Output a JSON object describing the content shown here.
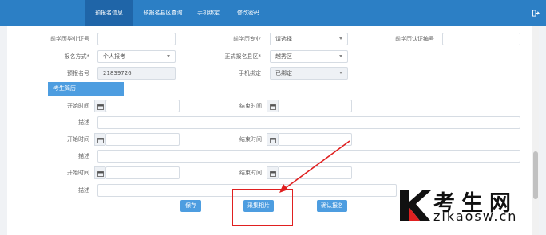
{
  "nav": {
    "tabs": [
      {
        "label": "预报名信息",
        "active": true
      },
      {
        "label": "预报名县区查询",
        "active": false
      },
      {
        "label": "手机绑定",
        "active": false
      },
      {
        "label": "修改密码",
        "active": false
      }
    ]
  },
  "form": {
    "prev_cert_label": "前学历毕业证号",
    "prev_cert_value": "",
    "prev_major_label": "前学历专业",
    "prev_major_value": "请选择",
    "prev_auth_label": "前学历认证编号",
    "prev_auth_value": "",
    "mode_label": "报名方式*",
    "mode_value": "个人报考",
    "area_label": "正式报名县区*",
    "area_value": "越秀区",
    "prereg_label": "预报名号",
    "prereg_value": "21839726",
    "phone_label": "手机绑定",
    "phone_value": "已绑定"
  },
  "resume": {
    "section_title": "考生简历",
    "start_label": "开始时间",
    "end_label": "结束时间",
    "desc_label": "描述",
    "rows": [
      {
        "start": "",
        "end": "",
        "desc": ""
      },
      {
        "start": "",
        "end": "",
        "desc": ""
      },
      {
        "start": "",
        "end": "",
        "desc": ""
      }
    ]
  },
  "actions": {
    "save": "保存",
    "photo": "采集相片",
    "confirm": "确认报名"
  },
  "watermark": {
    "title": "考生网",
    "url": "zikaosw.cn"
  },
  "colors": {
    "nav_bg": "#2c7fc5",
    "accent": "#4d9de0",
    "highlight": "#e02020"
  }
}
